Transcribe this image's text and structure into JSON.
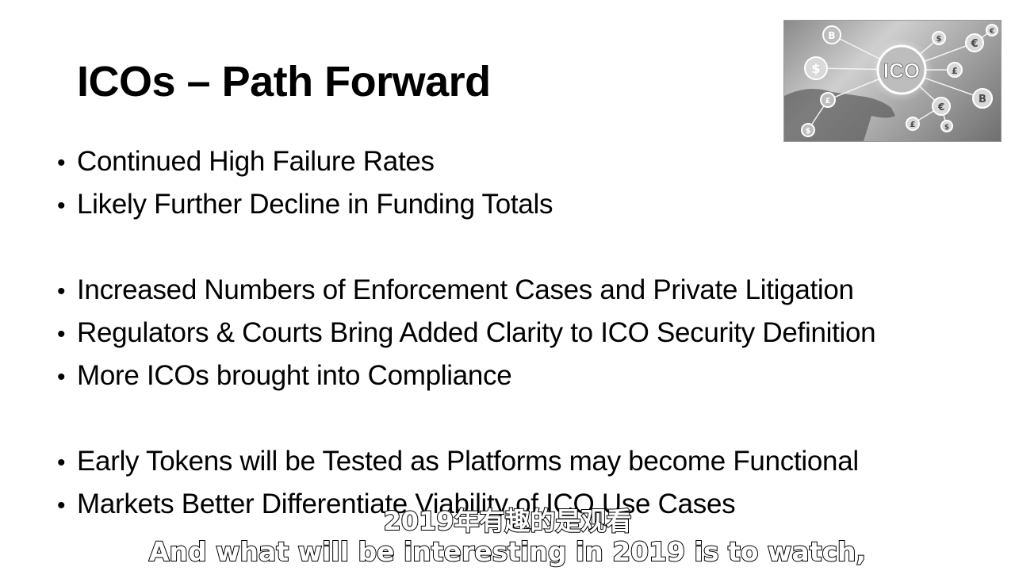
{
  "slide": {
    "title": "ICOs – Path Forward",
    "bullet_glyph": "•",
    "bullets": [
      "Continued High Failure Rates",
      "Likely Further Decline in Funding Totals",
      "Increased Numbers of Enforcement Cases and Private Litigation",
      "Regulators & Courts Bring Added Clarity to ICO Security Definition",
      "More ICOs brought into Compliance",
      "Early Tokens will be Tested as Platforms may become Functional",
      "Markets Better Differentiate Viability of ICO Use Cases"
    ]
  },
  "image": {
    "center_label": "ICO",
    "coin_symbols": [
      "$",
      "€",
      "£",
      "B",
      "$",
      "€",
      "£",
      "B",
      "$",
      "£",
      "€",
      "$"
    ],
    "icon": "ico-network-image"
  },
  "subtitles": {
    "chinese": "2019年有趣的是观看",
    "english": "And what will be interesting in 2019 is to watch,"
  }
}
